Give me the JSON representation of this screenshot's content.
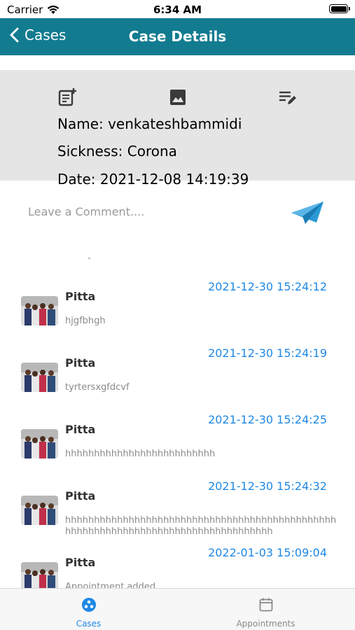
{
  "status_bar": {
    "carrier": "Carrier",
    "time": "6:34 AM"
  },
  "nav": {
    "back_label": "Cases",
    "title": "Case Details"
  },
  "case": {
    "actions": [
      "add-note-icon",
      "image-icon",
      "edit-list-icon"
    ],
    "name_line": "Name: venkateshbammidi",
    "sickness_line": "Sickness: Corona",
    "date_line": "Date: 2021-12-08 14:19:39"
  },
  "comment_box": {
    "placeholder": "Leave a Comment....",
    "value": ""
  },
  "comments": [
    {
      "name": "Pitta",
      "date": "2021-12-30 15:24:12",
      "text": "hjgfbhgh"
    },
    {
      "name": "Pitta",
      "date": "2021-12-30 15:24:19",
      "text": "tyrtersxgfdcvf"
    },
    {
      "name": "Pitta",
      "date": "2021-12-30 15:24:25",
      "text": "hhhhhhhhhhhhhhhhhhhhhhhhhh"
    },
    {
      "name": "Pitta",
      "date": "2021-12-30 15:24:32",
      "text": "hhhhhhhhhhhhhhhhhhhhhhhhhhhhhhhhhhhhhhhhhhhhhhhhhhhhhhhhhhhhhhhhhhhhhhhhhhhhhhhhhhh"
    },
    {
      "name": "Pitta",
      "date": "2022-01-03 15:09:04",
      "text": "Appointment added"
    }
  ],
  "tabs": [
    {
      "label": "Cases",
      "active": true
    },
    {
      "label": "Appointments",
      "active": false
    }
  ],
  "colors": {
    "nav": "#127b90",
    "accent": "#1e88e5",
    "panel": "#e5e5e5",
    "send": "#2a9ad6"
  }
}
